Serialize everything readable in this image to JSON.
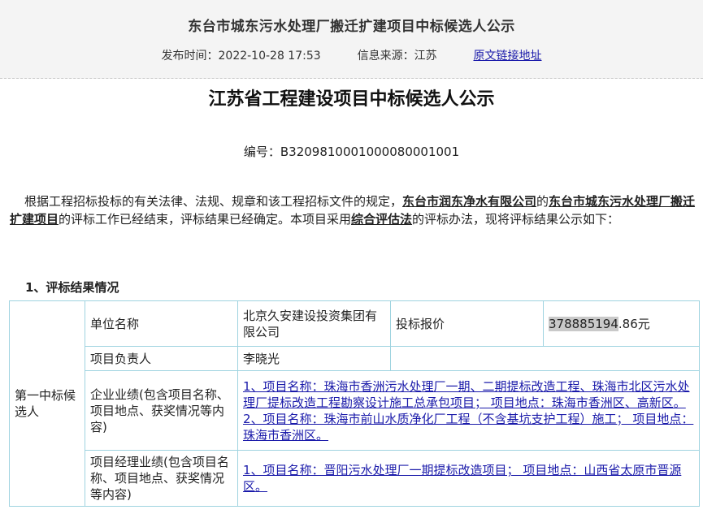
{
  "header": {
    "title": "东台市城东污水处理厂搬迁扩建项目中标候选人公示",
    "publish_label": "发布时间：",
    "publish_time": "2022-10-28 17:53",
    "source_label": "信息来源：",
    "source_value": "江苏",
    "original_link": "原文链接地址"
  },
  "doc": {
    "title": "江苏省工程建设项目中标候选人公示",
    "number": "编号：B3209810001000080001001",
    "para_a": "根据工程招标投标的有关法律、法规、规章和该工程招标文件的规定，",
    "para_owner": "东台市润东净水有限公司",
    "para_b": "的",
    "para_project": "东台市城东污水处理厂搬迁扩建项目",
    "para_c": "的评标工作已经结束，评标结果已经确定。本项目采用",
    "para_method": "综合评估法",
    "para_d": "的评标办法，现将评标结果公示如下："
  },
  "section1": {
    "title": "1、评标结果情况"
  },
  "table": {
    "candidate_label": "第一中标候选人",
    "unit_label": "单位名称",
    "unit_value": "北京久安建设投资集团有限公司",
    "bid_label": "投标报价",
    "bid_value_highlight": "378885194",
    "bid_value_rest": ".86元",
    "manager_label": "项目负责人",
    "manager_value": "李晓光",
    "company_perf_label": "企业业绩(包含项目名称、项目地点、获奖情况等内容)",
    "company_perf_value": "1、项目名称：珠海市香洲污水处理厂一期、二期提标改造工程、珠海市北区污水处理厂提标改造工程勘察设计施工总承包项目； 项目地点：珠海市香洲区、高新区。2、项目名称：珠海市前山水质净化厂工程（不含基坑支护工程）施工； 项目地点：珠海市香洲区。",
    "pm_perf_label": "项目经理业绩(包含项目名称、项目地点、获奖情况等内容)",
    "pm_perf_value": "1、项目名称：晋阳污水处理厂一期提标改造项目； 项目地点：山西省太原市晋源区。"
  }
}
